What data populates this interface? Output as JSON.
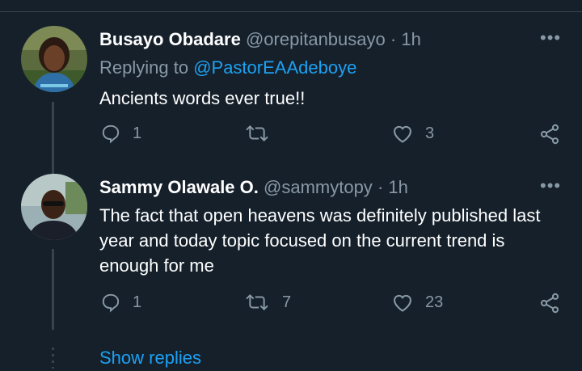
{
  "tweets": [
    {
      "name": "Busayo Obadare",
      "handle": "@orepitanbusayo",
      "separator": "·",
      "time": "1h",
      "replying_prefix": "Replying to ",
      "replying_to": "@PastorEAAdeboye",
      "text": "Ancients words ever true!!",
      "reply_count": "1",
      "retweet_count": "",
      "like_count": "3"
    },
    {
      "name": "Sammy Olawale O.",
      "handle": "@sammytopy",
      "separator": "·",
      "time": "1h",
      "text": "The fact that open heavens was  definitely published last year and today topic focused on the current trend is enough for me",
      "reply_count": "1",
      "retweet_count": "7",
      "like_count": "23"
    }
  ],
  "more_label": "•••",
  "show_replies": "Show replies",
  "colors": {
    "background": "#15202b",
    "divider": "#38444d",
    "secondary_text": "#8899a6",
    "accent": "#1da1f2"
  },
  "icons": [
    "reply-icon",
    "retweet-icon",
    "like-icon",
    "share-icon",
    "more-icon"
  ]
}
